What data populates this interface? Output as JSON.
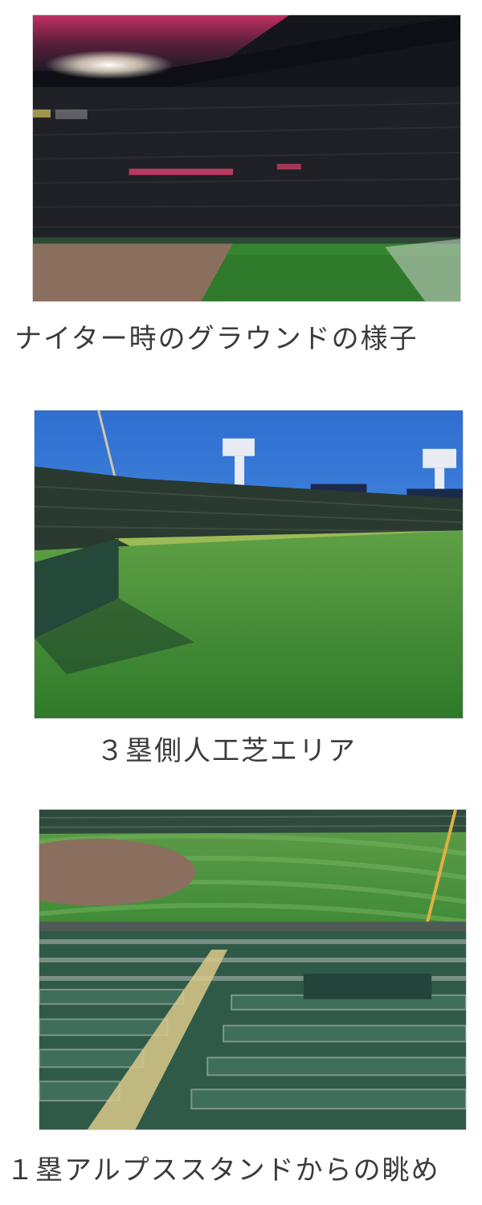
{
  "captions": {
    "night_ground": "ナイター時のグラウンドの様子",
    "third_base_turf": "３塁側人工芝エリア",
    "first_base_alps": "１塁アルプススタンドからの眺め"
  },
  "colors": {
    "night_sky": "#1b1b24",
    "night_glow": "#c03060",
    "grass": "#2f7a2a",
    "dirt": "#8b6f5e",
    "day_sky": "#3d7fd8",
    "seats": "#2f5a48"
  }
}
